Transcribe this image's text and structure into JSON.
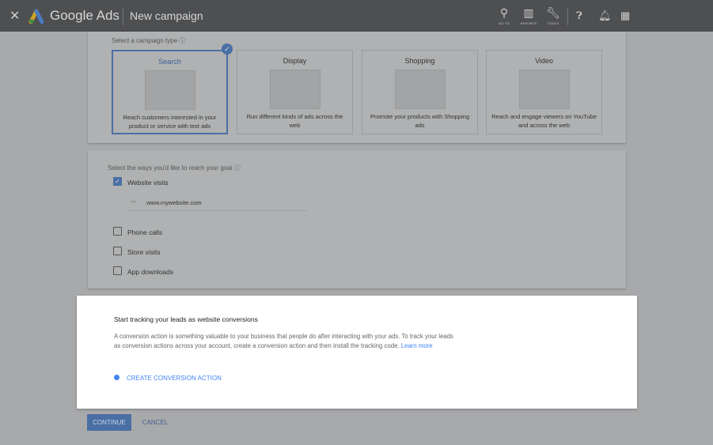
{
  "header": {
    "brand": "Google Ads",
    "title": "New campaign",
    "tools": [
      {
        "label": "GO TO",
        "icon": "search-icon"
      },
      {
        "label": "REPORTS",
        "icon": "reports-icon"
      },
      {
        "label": "TOOLS",
        "icon": "wrench-icon"
      }
    ],
    "icons": [
      "help-icon",
      "bell-icon",
      "apps-icon"
    ]
  },
  "campaign_type": {
    "label": "Select a campaign type",
    "selected": "Search",
    "types": [
      {
        "title": "Search",
        "desc": "Reach customers interested in your product or service with text ads"
      },
      {
        "title": "Display",
        "desc": "Run different kinds of ads across the web"
      },
      {
        "title": "Shopping",
        "desc": "Promote your products with Shopping ads"
      },
      {
        "title": "Video",
        "desc": "Reach and engage viewers on YouTube and across the web"
      }
    ]
  },
  "goals": {
    "label": "Select the ways you'd like to reach your goal",
    "options": [
      {
        "label": "Website visits",
        "checked": true
      },
      {
        "label": "Phone calls",
        "checked": false
      },
      {
        "label": "Store visits",
        "checked": false
      },
      {
        "label": "App downloads",
        "checked": false
      }
    ],
    "website_value": "www.mywebsite.com"
  },
  "conversion": {
    "title": "Start tracking your leads as website conversions",
    "body": "A conversion action is something valuable to your business that people do after interacting with your ads. To track your leads as conversion actions across your account, create a conversion action and then install the tracking code.",
    "learn_more": "Learn more",
    "action": "CREATE CONVERSION ACTION"
  },
  "footer": {
    "continue": "CONTINUE",
    "cancel": "CANCEL"
  },
  "colors": {
    "accent": "#4285f4",
    "header": "#4e4f51"
  }
}
